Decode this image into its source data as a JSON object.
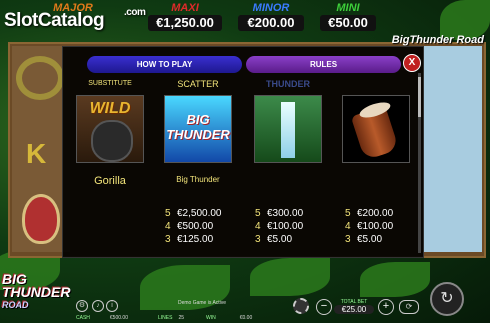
{
  "header": {
    "site_logo": "SlotCatalog",
    "site_logo_suffix": ".com",
    "jackpots": [
      {
        "label": "MAJOR",
        "value": "",
        "color": "#e07a1a"
      },
      {
        "label": "MAXI",
        "value": "€1,250.00",
        "color": "#e02a2a"
      },
      {
        "label": "MINOR",
        "value": "€200.00",
        "color": "#3a7bff"
      },
      {
        "label": "MINI",
        "value": "€50.00",
        "color": "#3dcf3a"
      }
    ]
  },
  "game_logo_top": "BigThunder Road",
  "modal": {
    "tabs": {
      "how_to_play": "HOW TO PLAY",
      "rules": "RULES"
    },
    "close": "X",
    "symbols": [
      {
        "header": "SUBSTITUTE",
        "art": "WILD",
        "name": "Gorilla",
        "pays": []
      },
      {
        "header": "SCATTER",
        "art": "BIG THUNDER",
        "name": "Big Thunder",
        "pays": [
          {
            "n": "5",
            "v": "€2,500.00"
          },
          {
            "n": "4",
            "v": "€500.00"
          },
          {
            "n": "3",
            "v": "€125.00"
          }
        ]
      },
      {
        "header": "THUNDER",
        "art": "",
        "name": "",
        "pays": [
          {
            "n": "5",
            "v": "€300.00"
          },
          {
            "n": "4",
            "v": "€100.00"
          },
          {
            "n": "3",
            "v": "€5.00"
          }
        ]
      },
      {
        "header": "",
        "art": "",
        "name": "",
        "pays": [
          {
            "n": "5",
            "v": "€200.00"
          },
          {
            "n": "4",
            "v": "€100.00"
          },
          {
            "n": "3",
            "v": "€5.00"
          }
        ]
      }
    ]
  },
  "footer": {
    "logo_line1": "BIG",
    "logo_line2": "THUNDER",
    "logo_line3": "ROAD",
    "demo_text": "Demo Game is Active",
    "cash_label": "CASH",
    "cash_value": "€500.00",
    "lines_label": "LINES",
    "lines_value": "25",
    "win_label": "WIN",
    "win_value": "€0.00",
    "total_bet_label": "TOTAL BET",
    "total_bet_value": "€25.00"
  }
}
